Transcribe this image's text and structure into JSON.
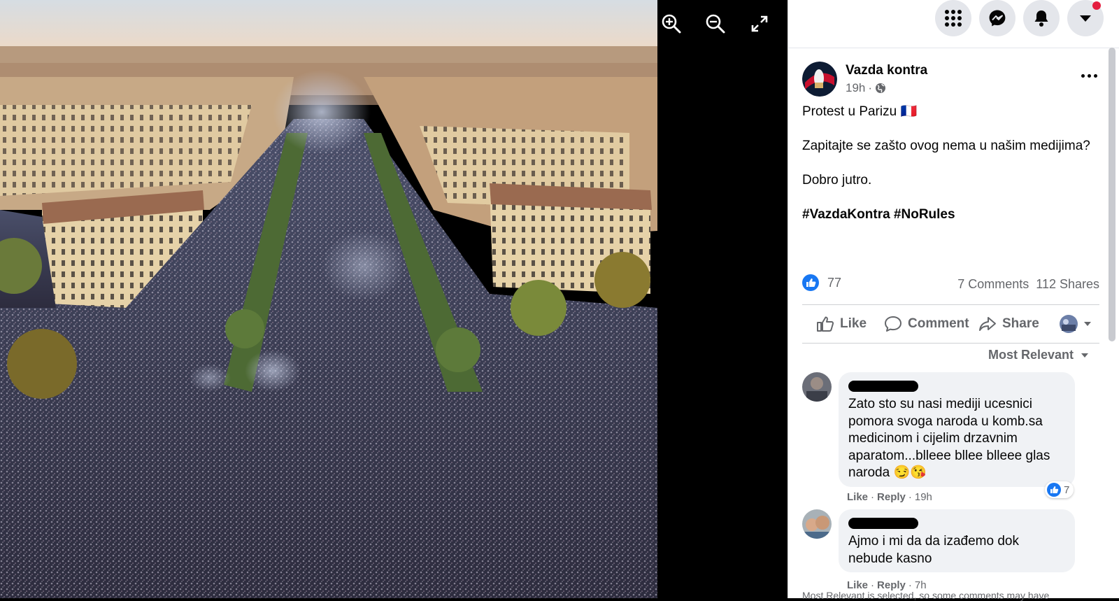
{
  "viewer": {
    "zoom_in": "zoom-in",
    "zoom_out": "zoom-out",
    "fullscreen": "fullscreen",
    "photo_alt": "Aerial photo of a massive crowd on a Paris boulevard"
  },
  "topbar": {
    "menu_icon": "grid-menu-icon",
    "messenger_icon": "messenger-icon",
    "notifications_icon": "bell-icon",
    "account_icon": "caret-down-icon"
  },
  "post": {
    "page_name": "Vazda kontra",
    "time": "19h",
    "visibility_icon": "globe-icon",
    "line1": "Protest u Parizu 🇫🇷",
    "line2": "Zapitajte se zašto ovog nema u našim medijima?",
    "line3": "Dobro jutro.",
    "hashtags": "#VazdaKontra #NoRules"
  },
  "stats": {
    "likes": "77",
    "comments": "7 Comments",
    "shares": "112 Shares"
  },
  "actions": {
    "like": "Like",
    "comment": "Comment",
    "share": "Share"
  },
  "sort": {
    "label": "Most Relevant"
  },
  "comments": [
    {
      "text": "Zato sto su nasi mediji ucesnici pomora svoga naroda u komb.sa medicinom i cijelim drzavnim aparatom...blleee bllee blleee glas naroda 😏😘",
      "like": "Like",
      "reply": "Reply",
      "time": "19h",
      "reactions": "7"
    },
    {
      "text": "Ajmo i mi da da izađemo dok nebude kasno",
      "like": "Like",
      "reply": "Reply",
      "time": "7h"
    }
  ],
  "footer_note": "Most Relevant is selected, so some comments may have",
  "colors": {
    "facebook_blue": "#1877f2",
    "text_secondary": "#65676b",
    "bubble_bg": "#f0f2f5",
    "notification_red": "#e41e3f"
  }
}
